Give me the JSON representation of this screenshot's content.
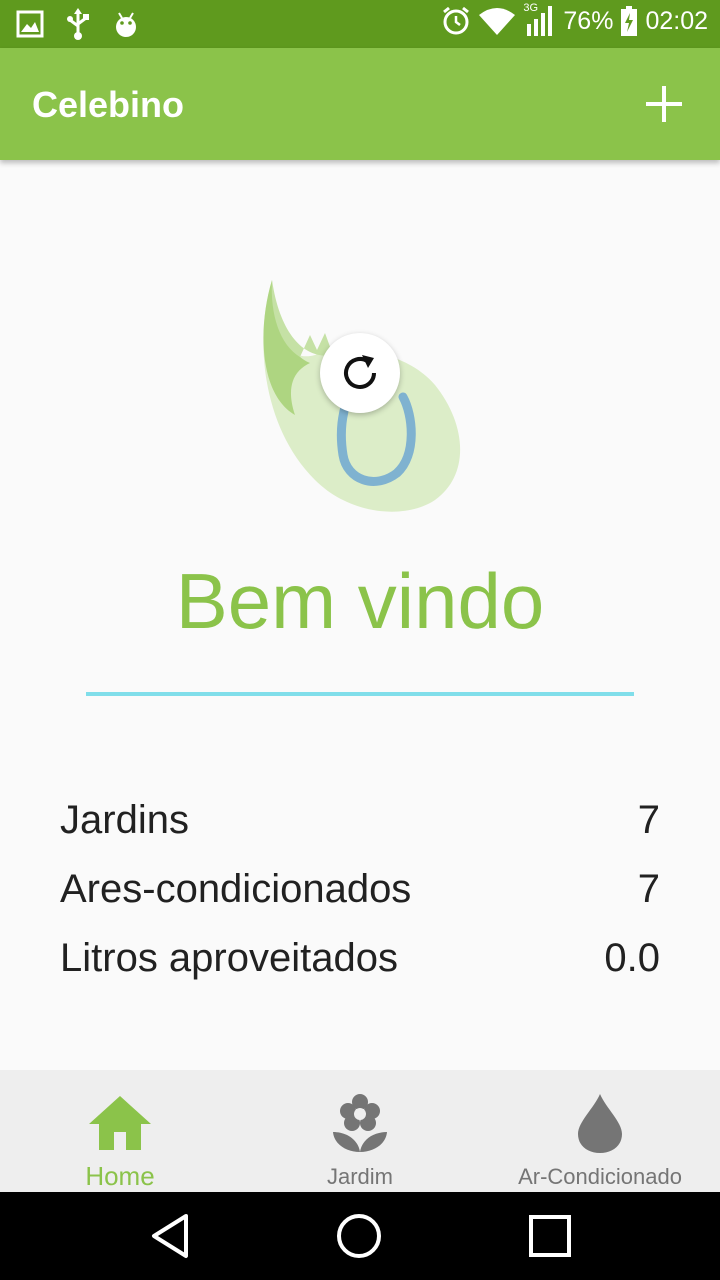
{
  "status_bar": {
    "network": "3G",
    "battery": "76%",
    "time": "02:02"
  },
  "app_bar": {
    "title": "Celebino",
    "add_icon": "plus-icon"
  },
  "main": {
    "welcome": "Bem vindo",
    "stats": [
      {
        "label": "Jardins",
        "value": "7"
      },
      {
        "label": "Ares-condicionados",
        "value": "7"
      },
      {
        "label": "Litros aproveitados",
        "value": "0.0"
      }
    ]
  },
  "bottom_nav": {
    "items": [
      {
        "label": "Home",
        "icon": "home-icon",
        "active": true
      },
      {
        "label": "Jardim",
        "icon": "flower-icon",
        "active": false
      },
      {
        "label": "Ar-Condicionado",
        "icon": "water-drop-icon",
        "active": false
      }
    ]
  },
  "colors": {
    "status_bar": "#5f9a1e",
    "primary": "#8bc34a",
    "divider": "#80deea",
    "text": "#212121",
    "nav_inactive": "#757575"
  }
}
